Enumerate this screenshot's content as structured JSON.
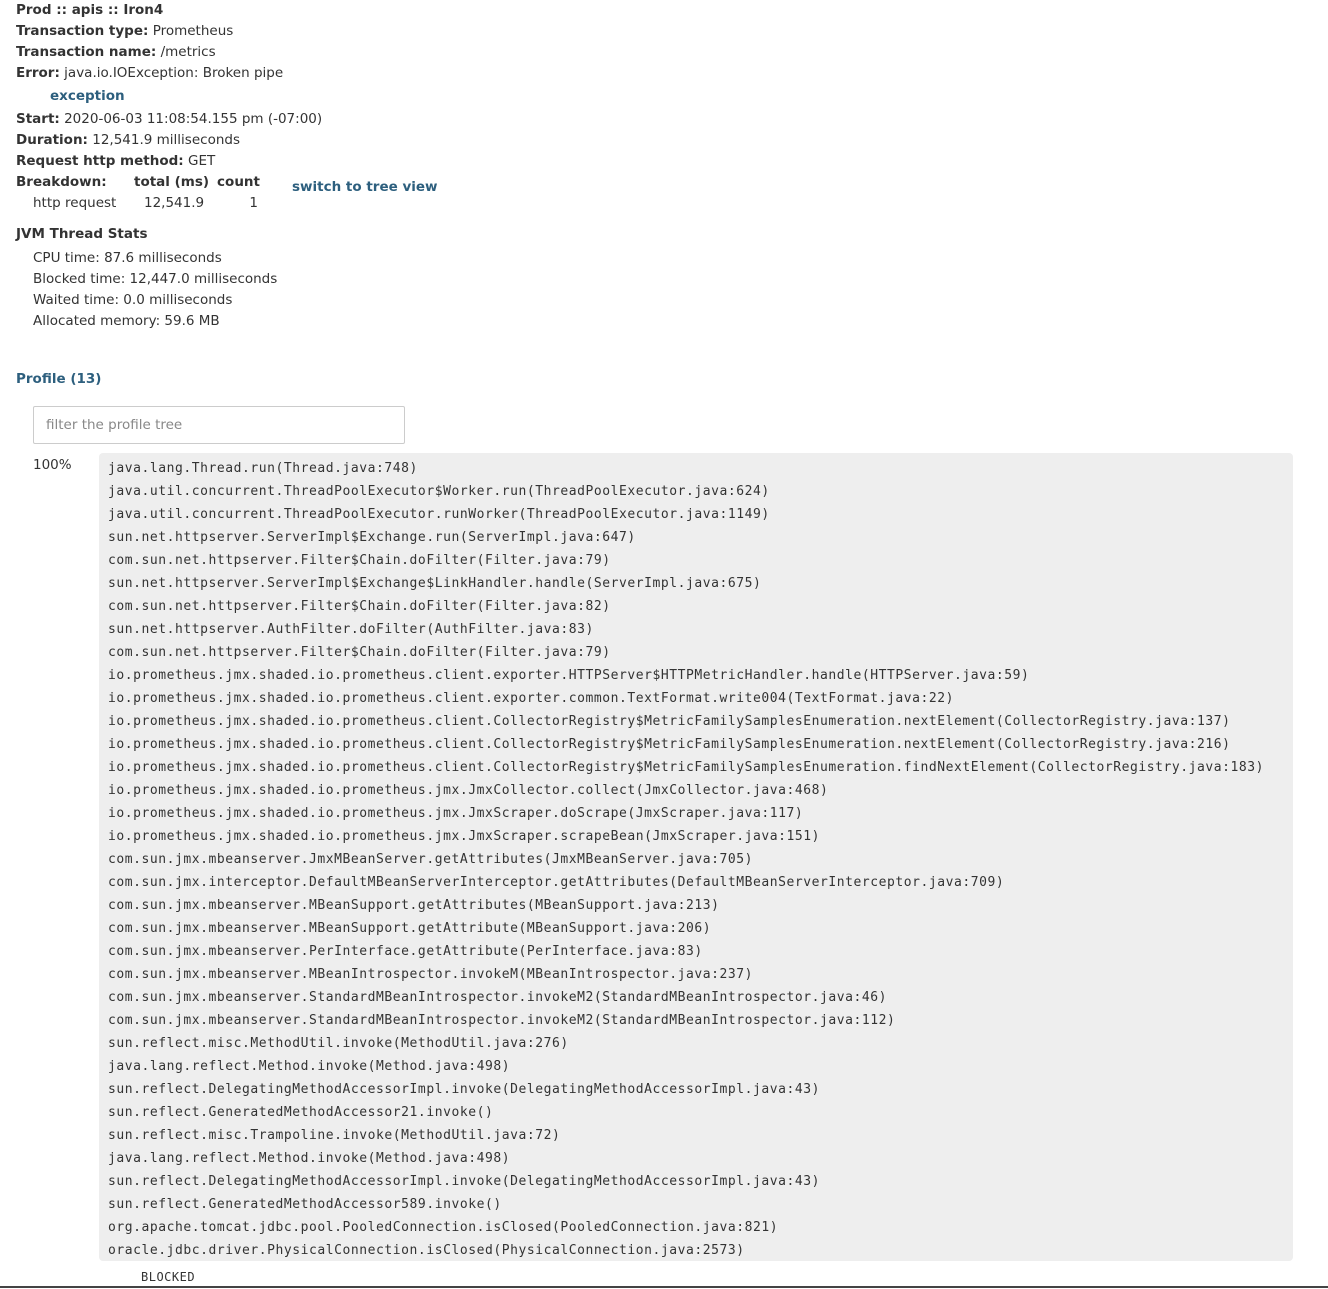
{
  "header": {
    "title": "Prod :: apis :: Iron4",
    "transaction_type_label": "Transaction type:",
    "transaction_type": "Prometheus",
    "transaction_name_label": "Transaction name:",
    "transaction_name": "/metrics",
    "error_label": "Error:",
    "error": "java.io.IOException: Broken pipe",
    "exception_link": "exception",
    "start_label": "Start:",
    "start": "2020-06-03 11:08:54.155 pm (-07:00)",
    "duration_label": "Duration:",
    "duration": "12,541.9 milliseconds",
    "method_label": "Request http method:",
    "method": "GET"
  },
  "breakdown": {
    "label": "Breakdown:",
    "col_total": "total (ms)",
    "col_count": "count",
    "rows": [
      {
        "name": "http request",
        "total": "12,541.9",
        "count": "1"
      }
    ],
    "switch_link": "switch to tree view"
  },
  "jvm": {
    "title": "JVM Thread Stats",
    "cpu": "CPU time: 87.6 milliseconds",
    "blocked": "Blocked time: 12,447.0 milliseconds",
    "waited": "Waited time: 0.0 milliseconds",
    "allocated": "Allocated memory: 59.6 MB"
  },
  "profile": {
    "title": "Profile (13)",
    "filter_placeholder": "filter the profile tree",
    "filter_value": "",
    "percent": "100%",
    "frames": [
      "java.lang.Thread.run(Thread.java:748)",
      "java.util.concurrent.ThreadPoolExecutor$Worker.run(ThreadPoolExecutor.java:624)",
      "java.util.concurrent.ThreadPoolExecutor.runWorker(ThreadPoolExecutor.java:1149)",
      "sun.net.httpserver.ServerImpl$Exchange.run(ServerImpl.java:647)",
      "com.sun.net.httpserver.Filter$Chain.doFilter(Filter.java:79)",
      "sun.net.httpserver.ServerImpl$Exchange$LinkHandler.handle(ServerImpl.java:675)",
      "com.sun.net.httpserver.Filter$Chain.doFilter(Filter.java:82)",
      "sun.net.httpserver.AuthFilter.doFilter(AuthFilter.java:83)",
      "com.sun.net.httpserver.Filter$Chain.doFilter(Filter.java:79)",
      "io.prometheus.jmx.shaded.io.prometheus.client.exporter.HTTPServer$HTTPMetricHandler.handle(HTTPServer.java:59)",
      "io.prometheus.jmx.shaded.io.prometheus.client.exporter.common.TextFormat.write004(TextFormat.java:22)",
      "io.prometheus.jmx.shaded.io.prometheus.client.CollectorRegistry$MetricFamilySamplesEnumeration.nextElement(CollectorRegistry.java:137)",
      "io.prometheus.jmx.shaded.io.prometheus.client.CollectorRegistry$MetricFamilySamplesEnumeration.nextElement(CollectorRegistry.java:216)",
      "io.prometheus.jmx.shaded.io.prometheus.client.CollectorRegistry$MetricFamilySamplesEnumeration.findNextElement(CollectorRegistry.java:183)",
      "io.prometheus.jmx.shaded.io.prometheus.jmx.JmxCollector.collect(JmxCollector.java:468)",
      "io.prometheus.jmx.shaded.io.prometheus.jmx.JmxScraper.doScrape(JmxScraper.java:117)",
      "io.prometheus.jmx.shaded.io.prometheus.jmx.JmxScraper.scrapeBean(JmxScraper.java:151)",
      "com.sun.jmx.mbeanserver.JmxMBeanServer.getAttributes(JmxMBeanServer.java:705)",
      "com.sun.jmx.interceptor.DefaultMBeanServerInterceptor.getAttributes(DefaultMBeanServerInterceptor.java:709)",
      "com.sun.jmx.mbeanserver.MBeanSupport.getAttributes(MBeanSupport.java:213)",
      "com.sun.jmx.mbeanserver.MBeanSupport.getAttribute(MBeanSupport.java:206)",
      "com.sun.jmx.mbeanserver.PerInterface.getAttribute(PerInterface.java:83)",
      "com.sun.jmx.mbeanserver.MBeanIntrospector.invokeM(MBeanIntrospector.java:237)",
      "com.sun.jmx.mbeanserver.StandardMBeanIntrospector.invokeM2(StandardMBeanIntrospector.java:46)",
      "com.sun.jmx.mbeanserver.StandardMBeanIntrospector.invokeM2(StandardMBeanIntrospector.java:112)",
      "sun.reflect.misc.MethodUtil.invoke(MethodUtil.java:276)",
      "java.lang.reflect.Method.invoke(Method.java:498)",
      "sun.reflect.DelegatingMethodAccessorImpl.invoke(DelegatingMethodAccessorImpl.java:43)",
      "sun.reflect.GeneratedMethodAccessor21.invoke()",
      "sun.reflect.misc.Trampoline.invoke(MethodUtil.java:72)",
      "java.lang.reflect.Method.invoke(Method.java:498)",
      "sun.reflect.DelegatingMethodAccessorImpl.invoke(DelegatingMethodAccessorImpl.java:43)",
      "sun.reflect.GeneratedMethodAccessor589.invoke()",
      "org.apache.tomcat.jdbc.pool.PooledConnection.isClosed(PooledConnection.java:821)",
      "oracle.jdbc.driver.PhysicalConnection.isClosed(PhysicalConnection.java:2573)"
    ],
    "thread_state": "BLOCKED"
  },
  "colors": {
    "link": "#2d5f7e",
    "text": "#333333",
    "tree_background": "#eeeeee"
  }
}
